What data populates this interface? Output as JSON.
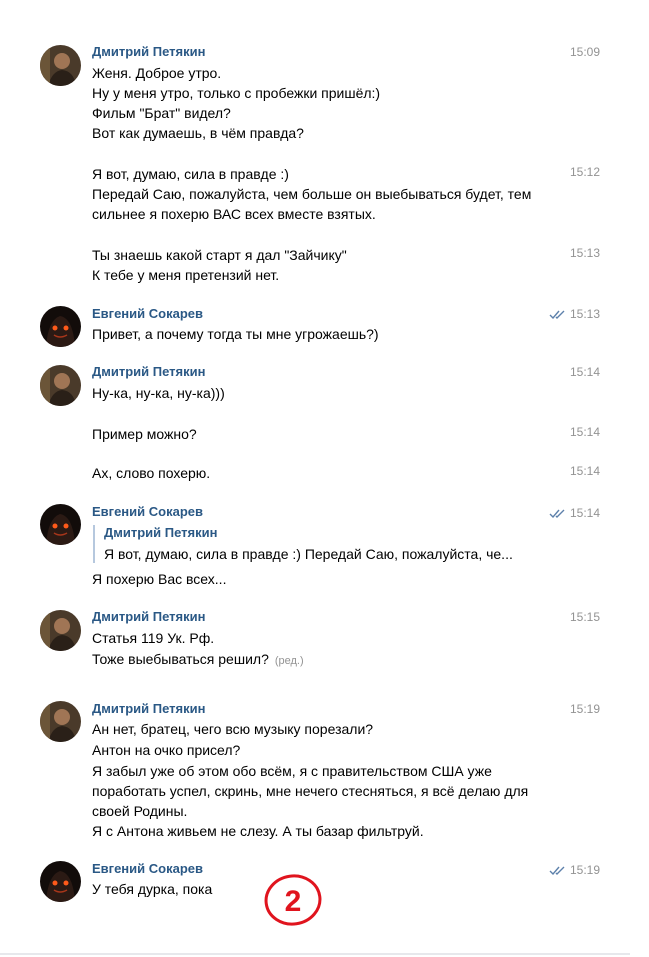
{
  "messages": [
    {
      "author": "Дмитрий Петякин",
      "time": "15:09",
      "lines": [
        "Женя. Доброе утро.",
        "Ну у меня утро, только с пробежки пришёл:)",
        "Фильм \"Брат\" видел?",
        "Вот как думаешь, в чём правда?"
      ]
    },
    {
      "time": "15:12",
      "lines": [
        "Я вот, думаю, сила в правде :)",
        "Передай Саю, пожалуйста, чем больше он выебываться будет, тем",
        "сильнее я похерю ВАС всех вместе взятых."
      ]
    },
    {
      "time": "15:13",
      "lines": [
        "Ты знаешь какой старт я дал \"Зайчику\"",
        "К тебе у меня претензий нет."
      ]
    },
    {
      "author": "Евгений Сокарев",
      "time": "15:13",
      "lines": [
        "Привет, а почему тогда ты мне угрожаешь?)"
      ]
    },
    {
      "author": "Дмитрий Петякин",
      "time": "15:14",
      "lines": [
        "Ну-ка, ну-ка, ну-ка)))"
      ]
    },
    {
      "time": "15:14",
      "lines": [
        "Пример можно?"
      ]
    },
    {
      "time": "15:14",
      "lines": [
        "Ах, слово похерю."
      ]
    },
    {
      "author": "Евгений Сокарев",
      "time": "15:14",
      "quote_author": "Дмитрий Петякин",
      "quote_text": "Я вот, думаю, сила в правде :) Передай Саю, пожалуйста, че...",
      "lines": [
        "Я похерю Вас всех..."
      ]
    },
    {
      "author": "Дмитрий Петякин",
      "time": "15:15",
      "lines": [
        "Статья 119 Ук. Рф.",
        "Тоже выебываться решил?"
      ],
      "edited": "(ред.)"
    },
    {
      "author": "Дмитрий Петякин",
      "time": "15:19",
      "lines": [
        "Ан нет, братец, чего всю музыку порезали?",
        "Антон на очко присел?",
        "Я забыл уже об этом обо всём, я с правительством США уже",
        "поработать успел, скринь, мне нечего стесняться, я всё делаю для",
        "своей Родины.",
        "Я с Антона живьем не слезу. А ты базар фильтруй."
      ]
    },
    {
      "author": "Евгений Сокарев",
      "time": "15:19",
      "lines": [
        "У тебя дурка, пока"
      ]
    }
  ],
  "annotation": "2",
  "colors": {
    "author": "#2a5885",
    "time": "#939393",
    "check": "#5d81ab",
    "annotation": "#e0141e"
  }
}
